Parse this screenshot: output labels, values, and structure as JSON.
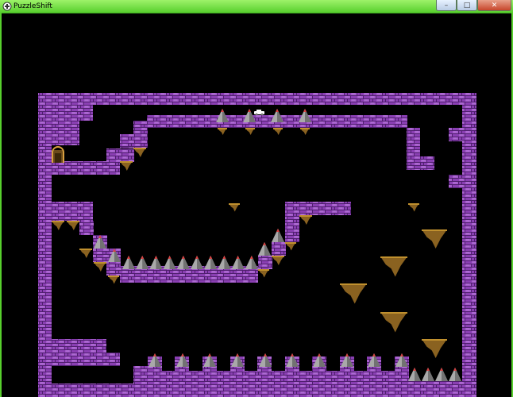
{
  "window": {
    "title": "PuzzleShift",
    "minimize_symbol": "–",
    "maximize_symbol": "□",
    "close_symbol": "✕",
    "app_icon": "game-controller-icon"
  },
  "colors": {
    "titlebar_accent": "#57cf2d",
    "background": "#000000",
    "brick": "#8a3fb3",
    "brick_light": "#b576d8",
    "brick_dark": "#4f1f6e",
    "spike": "#a9a9a9",
    "spike_tip": "#d84040",
    "rock": "#8a6220"
  },
  "level": {
    "exit_door": "arched-door-icon",
    "player": "white-car-sprite",
    "hazard": "spike-icon",
    "platform": "floating-rock-icon"
  }
}
